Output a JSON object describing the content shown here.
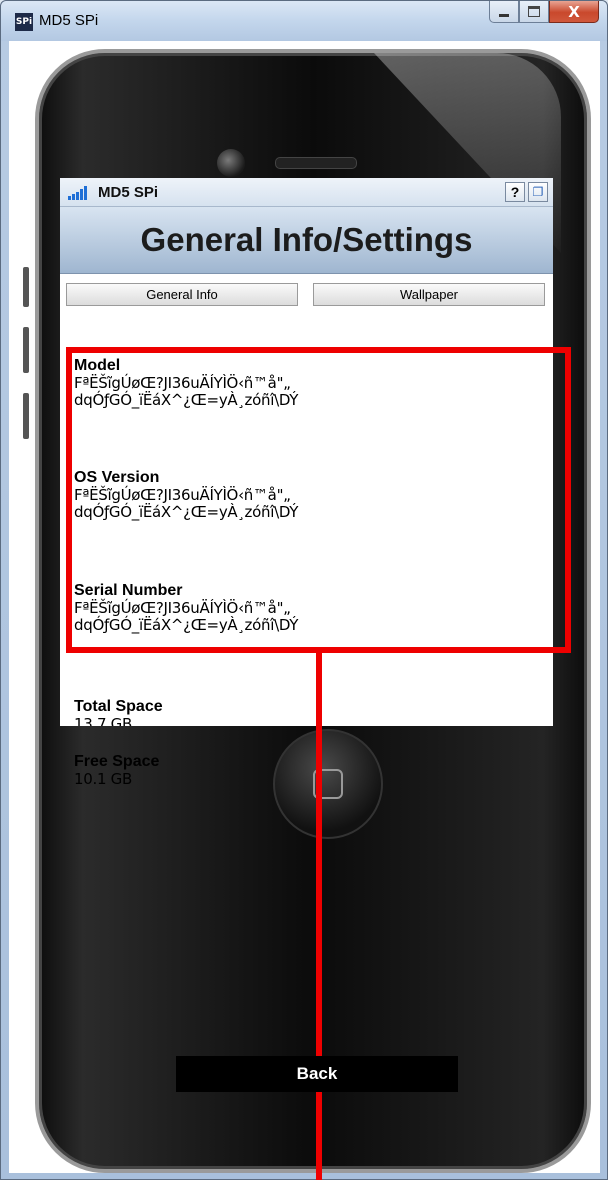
{
  "window": {
    "title": "MD5 SPi",
    "icon_text": "SPi",
    "close_glyph": "X"
  },
  "app": {
    "name": "MD5 SPi",
    "help_label": "?",
    "header_title": "General Info/Settings",
    "tabs": [
      {
        "label": "General Info"
      },
      {
        "label": "Wallpaper"
      }
    ],
    "fields": [
      {
        "label": "Model",
        "value": "FªËŠĩgÚøŒ?JI36uÄÍYÌÖ‹ñ™å\"„\ndqÓƒGÓ_ïËáX^¿Œ=yÀ¸zóñî\\DÝ"
      },
      {
        "label": "OS Version",
        "value": "FªËŠĩgÚøŒ?JI36uÄÍYÌÖ‹ñ™å\"„\ndqÓƒGÓ_ïËáX^¿Œ=yÀ¸zóñî\\DÝ"
      },
      {
        "label": "Serial Number",
        "value": "FªËŠĩgÚøŒ?JI36uÄÍYÌÖ‹ñ™å\"„\ndqÓƒGÓ_ïËáX^¿Œ=yÀ¸zóñî\\DÝ"
      },
      {
        "label": "Total Space",
        "value": "13.7 GB"
      },
      {
        "label": "Free Space",
        "value": "10.1 GB"
      }
    ],
    "back_label": "Back"
  },
  "colors": {
    "highlight": "#ee0000",
    "signal": "#1f6fd6"
  },
  "icons": [
    "spi-app-icon",
    "minimize-icon",
    "maximize-icon",
    "close-icon",
    "signal-icon",
    "help-icon",
    "restore-icon",
    "home-button-icon"
  ]
}
